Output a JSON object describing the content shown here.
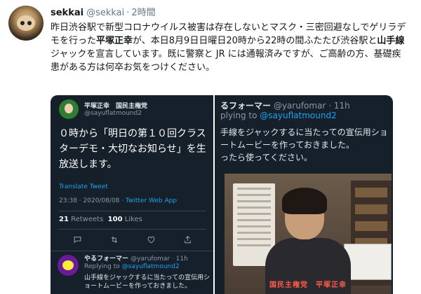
{
  "tweet": {
    "name": "sekkai",
    "handle": "@sekkai",
    "separator": "·",
    "time": "2時間",
    "text_parts": [
      "昨日渋谷駅で新型コロナウイルス被害は存在しないとマスク・三密回避なしでゲリラデモを行った",
      "平塚正幸",
      "が、本日8月9日日曜日20時から22時の間ふたたび渋谷駅と",
      "山手線",
      "ジャックを宣言しています。既に警察と JR には通報済みですが、ご高齢の方、基礎疾患がある方は何卒お気をつけください。"
    ]
  },
  "left_card": {
    "name": "平塚正幸　国民主権党",
    "handle": "@sayuflatmound2",
    "body": "０時から「明日の第１０回クラスターデモ・大切なお知らせ」を生放送します。",
    "translate": "Translate Tweet",
    "timestamp": "23:38 · 2020/08/08 · ",
    "app": "Twitter Web App",
    "retweets_count": "21",
    "retweets_label": " Retweets  ",
    "likes_count": "100",
    "likes_label": " Likes",
    "reply": {
      "name": "やるフォーマー",
      "handle": "@yarufomar · 11h",
      "replying_prefix": "Replying to ",
      "replying_to": "@sayuflatmound2",
      "text": "山手線をジャックするに当たっての宣伝用ショートムービーを作っておきました。"
    }
  },
  "right_card": {
    "name": "るフォーマー",
    "handle": " @yarufomar · 11h",
    "replying_prefix": "plying to ",
    "replying_to": "@sayuflatmound2",
    "body": "手線をジャックするに当たっての宣伝用ショートムービーを作っておきました。\nったら使ってください。",
    "video_caption": "国民主権党　平塚正幸"
  },
  "colors": {
    "link": "#1da1f2",
    "dark_bg": "#15202b",
    "caption_red": "#ff5a4a"
  }
}
